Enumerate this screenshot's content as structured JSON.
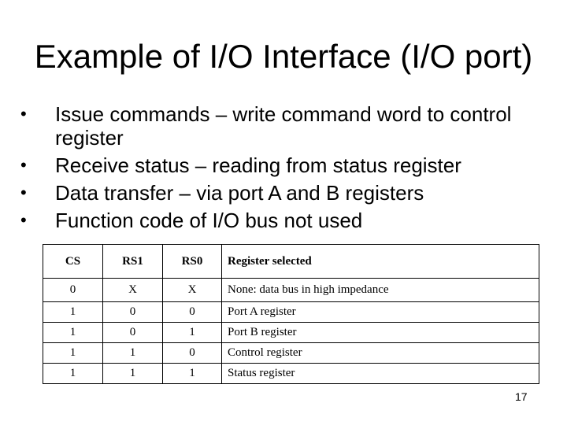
{
  "slide": {
    "title": "Example of I/O Interface (I/O port)",
    "bullet_icon": "•",
    "bullets": [
      "Issue commands – write command word to control register",
      "Receive status – reading from status register",
      "Data transfer – via port A and B registers",
      "Function code of I/O bus not used"
    ],
    "table": {
      "headers": [
        "CS",
        "RS1",
        "RS0",
        "Register selected"
      ],
      "rows": [
        [
          "0",
          "X",
          "X",
          "None: data bus in high impedance"
        ],
        [
          "1",
          "0",
          "0",
          "Port A register"
        ],
        [
          "1",
          "0",
          "1",
          "Port B register"
        ],
        [
          "1",
          "1",
          "0",
          "Control register"
        ],
        [
          "1",
          "1",
          "1",
          "Status register"
        ]
      ]
    },
    "page_number": "17"
  }
}
